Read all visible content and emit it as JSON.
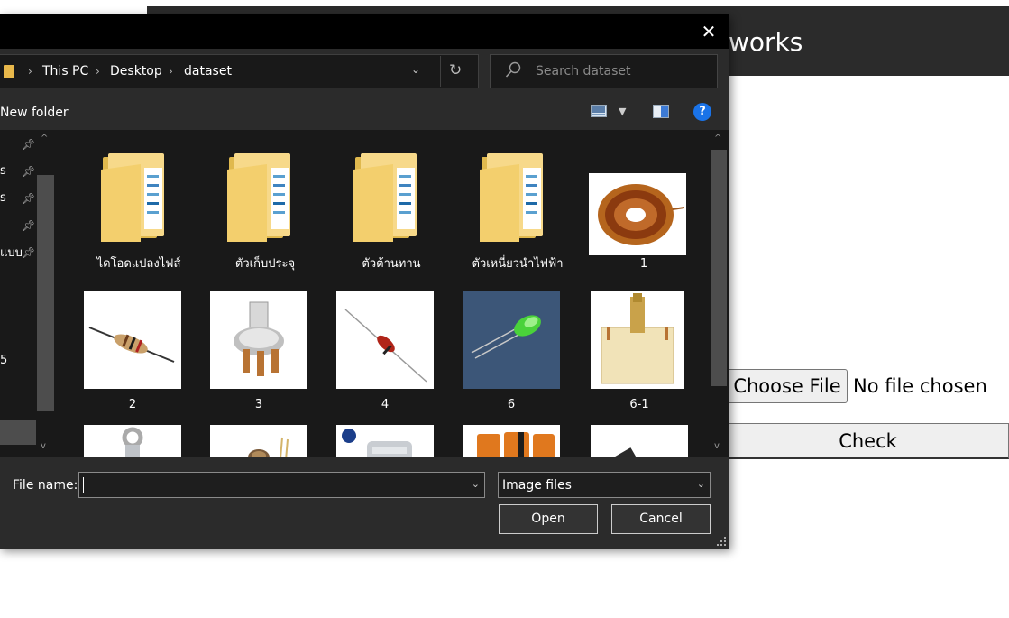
{
  "background_page": {
    "title_fragment": "works",
    "choose_file_label": "Choose File",
    "no_file_text": "No file chosen",
    "check_label": "Check"
  },
  "dialog": {
    "close_glyph": "✕",
    "breadcrumbs": [
      "This PC",
      "Desktop",
      "dataset"
    ],
    "search_placeholder": "Search dataset",
    "new_folder_label": "New folder",
    "help_glyph": "?",
    "nav_items": [
      {
        "label": "s",
        "pinned": true
      },
      {
        "label": "s",
        "pinned": true
      },
      {
        "label": "",
        "pinned": true
      },
      {
        "label": "แบบ",
        "pinned": true
      },
      {
        "label": "5",
        "pinned": false
      }
    ],
    "files": [
      {
        "label": "ไดโอดแปลงไฟส์",
        "kind": "folder"
      },
      {
        "label": "ตัวเก็บประจุ",
        "kind": "folder"
      },
      {
        "label": "ตัวต้านทาน",
        "kind": "folder"
      },
      {
        "label": "ตัวเหนี่ยวนำไฟฟ้า",
        "kind": "folder"
      },
      {
        "label": "1",
        "kind": "image",
        "icon": "toroid-inductor-thumbnail"
      },
      {
        "label": "2",
        "kind": "image",
        "icon": "resistor-thumbnail"
      },
      {
        "label": "3",
        "kind": "image",
        "icon": "potentiometer-thumbnail"
      },
      {
        "label": "4",
        "kind": "image",
        "icon": "diode-thumbnail"
      },
      {
        "label": "6",
        "kind": "image",
        "icon": "green-led-thumbnail"
      },
      {
        "label": "6-1",
        "kind": "image",
        "icon": "variable-capacitor-thumbnail"
      },
      {
        "label": "",
        "kind": "image",
        "icon": "lug-terminal-thumbnail"
      },
      {
        "label": "",
        "kind": "image",
        "icon": "photoresistor-thumbnail"
      },
      {
        "label": "",
        "kind": "image",
        "icon": "relay-thumbnail"
      },
      {
        "label": "",
        "kind": "image",
        "icon": "electrolytic-capacitors-thumbnail"
      },
      {
        "label": "",
        "kind": "image",
        "icon": "transistor-thumbnail"
      }
    ],
    "file_name_label": "File name:",
    "file_name_value": "",
    "file_type": "Image files",
    "open_label": "Open",
    "cancel_label": "Cancel"
  },
  "colors": {
    "dialog_bg": "#2b2b2b",
    "pane_bg": "#191919",
    "help_blue": "#1a73e8",
    "folder_yellow": "#f3cf6d"
  }
}
